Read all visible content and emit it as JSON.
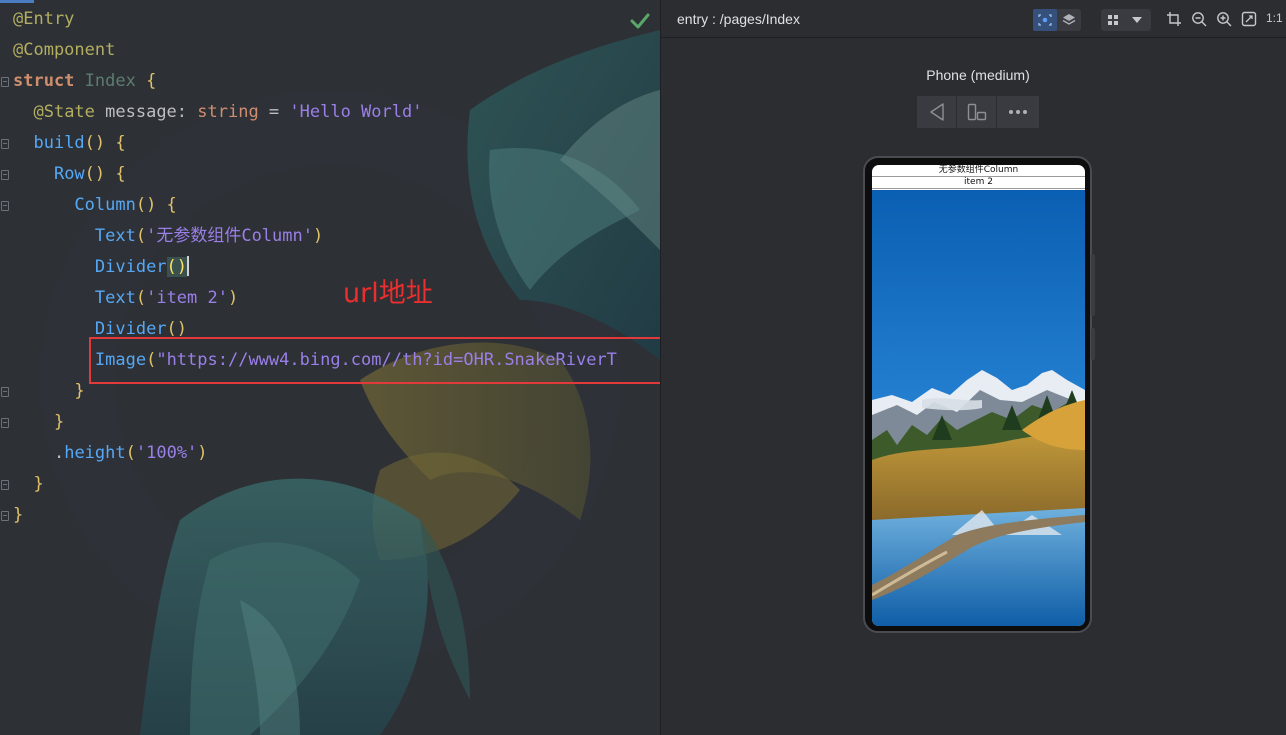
{
  "editor": {
    "lines": [
      {
        "indent": "",
        "tokens": [
          {
            "c": "an",
            "t": "@Entry"
          }
        ]
      },
      {
        "indent": "",
        "tokens": [
          {
            "c": "an",
            "t": "@Component"
          }
        ]
      },
      {
        "indent": "",
        "tokens": [
          {
            "c": "k",
            "t": "struct "
          },
          {
            "c": "cl",
            "t": "Index "
          },
          {
            "c": "pn",
            "t": "{"
          }
        ]
      },
      {
        "indent": "  ",
        "tokens": [
          {
            "c": "an",
            "t": "@State "
          },
          {
            "c": "pw",
            "t": "message: "
          },
          {
            "c": "tp",
            "t": "string "
          },
          {
            "c": "pw",
            "t": "= "
          },
          {
            "c": "st",
            "t": "'Hello World'"
          }
        ]
      },
      {
        "indent": "  ",
        "tokens": [
          {
            "c": "fn",
            "t": "build"
          },
          {
            "c": "pn",
            "t": "() {"
          }
        ]
      },
      {
        "indent": "    ",
        "tokens": [
          {
            "c": "cp",
            "t": "Row"
          },
          {
            "c": "pn",
            "t": "() {"
          }
        ]
      },
      {
        "indent": "      ",
        "tokens": [
          {
            "c": "cp",
            "t": "Column"
          },
          {
            "c": "pn",
            "t": "() {"
          }
        ]
      },
      {
        "indent": "        ",
        "tokens": [
          {
            "c": "cp",
            "t": "Text"
          },
          {
            "c": "pn",
            "t": "("
          },
          {
            "c": "st",
            "t": "'无参数组件Column'"
          },
          {
            "c": "pn",
            "t": ")"
          }
        ]
      },
      {
        "indent": "        ",
        "tokens": [
          {
            "c": "cp",
            "t": "Divider"
          },
          {
            "c": "bm",
            "t": "()"
          },
          {
            "c": "caret",
            "t": ""
          }
        ]
      },
      {
        "indent": "        ",
        "tokens": [
          {
            "c": "cp",
            "t": "Text"
          },
          {
            "c": "pn",
            "t": "("
          },
          {
            "c": "st",
            "t": "'item 2'"
          },
          {
            "c": "pn",
            "t": ")"
          }
        ]
      },
      {
        "indent": "        ",
        "tokens": [
          {
            "c": "cp",
            "t": "Divider"
          },
          {
            "c": "pn",
            "t": "()"
          }
        ]
      },
      {
        "indent": "        ",
        "tokens": [
          {
            "c": "cp",
            "t": "Image"
          },
          {
            "c": "pn",
            "t": "("
          },
          {
            "c": "st",
            "t": "\"https://www4.bing.com//th?id=OHR.SnakeRiverT"
          }
        ]
      },
      {
        "indent": "      ",
        "tokens": [
          {
            "c": "pn",
            "t": "}"
          }
        ]
      },
      {
        "indent": "    ",
        "tokens": [
          {
            "c": "pn",
            "t": "}"
          }
        ]
      },
      {
        "indent": "    ",
        "tokens": [
          {
            "c": "pw",
            "t": "."
          },
          {
            "c": "fn",
            "t": "height"
          },
          {
            "c": "pn",
            "t": "("
          },
          {
            "c": "st",
            "t": "'100%'"
          },
          {
            "c": "pn",
            "t": ")"
          }
        ]
      },
      {
        "indent": "  ",
        "tokens": [
          {
            "c": "pn",
            "t": "}"
          }
        ]
      },
      {
        "indent": "",
        "tokens": [
          {
            "c": "pn",
            "t": "}"
          }
        ]
      }
    ],
    "annotation": "url地址",
    "status_icon": "check-icon",
    "status_color": "#59a869"
  },
  "preview": {
    "title": "entry : /pages/Index",
    "device_label": "Phone (medium)",
    "toolbar_icons": [
      "inspect-icon",
      "layers-icon",
      "grid-icon",
      "chevron-down-icon",
      "crop-icon",
      "zoom-out-icon",
      "zoom-in-icon",
      "fit-screen-icon",
      "actual-size-icon"
    ],
    "actual_size_label": "1:1",
    "nav_icons": [
      "back-icon",
      "rotate-device-icon",
      "more-icon"
    ],
    "screen": {
      "text1": "无参数组件Column",
      "text2": "item 2",
      "image_icon": "mountain-lake-image"
    }
  },
  "colors": {
    "accent": "#3574f0",
    "annotation_red": "#ec2e2e",
    "editor_bg": "#2d3035",
    "panel_bg": "#2b2d30"
  }
}
